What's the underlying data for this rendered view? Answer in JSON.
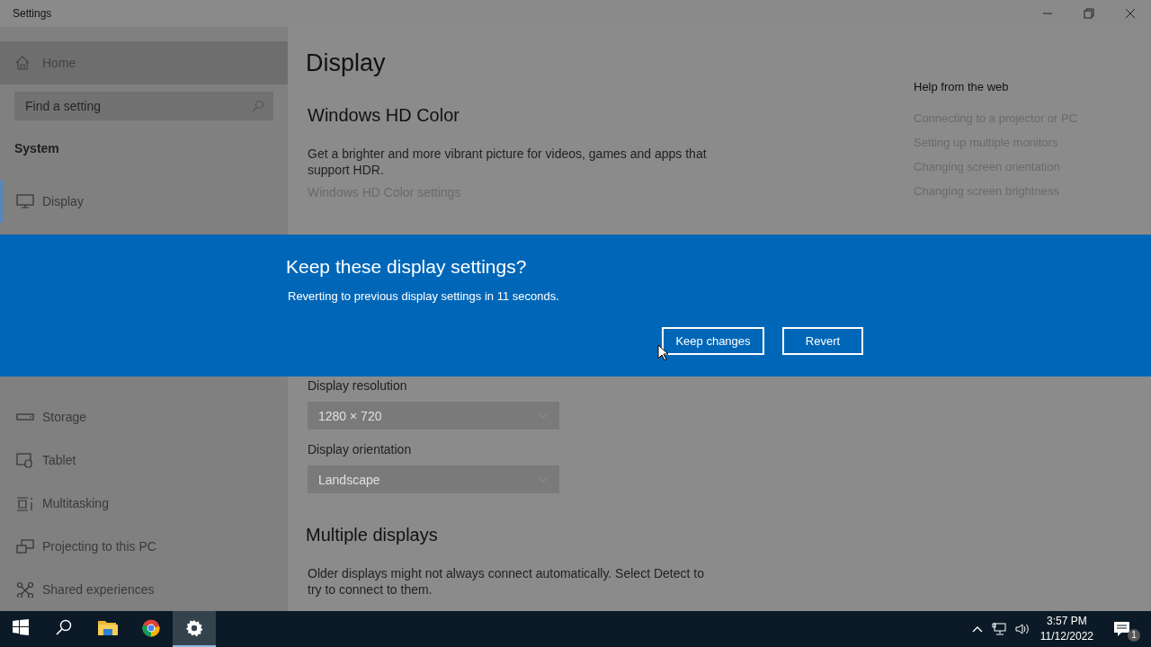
{
  "window": {
    "title": "Settings"
  },
  "sidebar": {
    "home": {
      "label": "Home"
    },
    "search": {
      "placeholder": "Find a setting"
    },
    "section": "System",
    "items_above_dialog": [
      {
        "kind": "display",
        "label": "Display",
        "selected": true
      }
    ],
    "items_below_dialog": [
      {
        "kind": "storage",
        "label": "Storage",
        "selected": false
      },
      {
        "kind": "tablet",
        "label": "Tablet",
        "selected": false
      },
      {
        "kind": "multitasking",
        "label": "Multitasking",
        "selected": false
      },
      {
        "kind": "projecting",
        "label": "Projecting to this PC",
        "selected": false
      },
      {
        "kind": "shared",
        "label": "Shared experiences",
        "selected": false
      }
    ]
  },
  "main": {
    "title": "Display",
    "hd_color": {
      "heading": "Windows HD Color",
      "description": "Get a brighter and more vibrant picture for videos, games and apps that support HDR.",
      "link": "Windows HD Color settings"
    },
    "resolution": {
      "label": "Display resolution",
      "value": "1280 × 720"
    },
    "orientation": {
      "label": "Display orientation",
      "value": "Landscape"
    },
    "multiple_displays": {
      "heading": "Multiple displays",
      "description": "Older displays might not always connect automatically. Select Detect to try to connect to them."
    }
  },
  "help": {
    "heading": "Help from the web",
    "links": [
      "Connecting to a projector or PC",
      "Setting up multiple monitors",
      "Changing screen orientation",
      "Changing screen brightness"
    ]
  },
  "dialog": {
    "title": "Keep these display settings?",
    "message": "Reverting to previous display settings in 11 seconds.",
    "buttons": [
      "Keep changes",
      "Revert"
    ]
  },
  "taskbar": {
    "apps": [
      {
        "kind": "start",
        "active": false
      },
      {
        "kind": "search",
        "active": false
      },
      {
        "kind": "explorer",
        "active": false
      },
      {
        "kind": "chrome",
        "active": false
      },
      {
        "kind": "settings",
        "active": true
      }
    ],
    "time": "3:57 PM",
    "date": "11/12/2022",
    "notification_count": "1"
  }
}
